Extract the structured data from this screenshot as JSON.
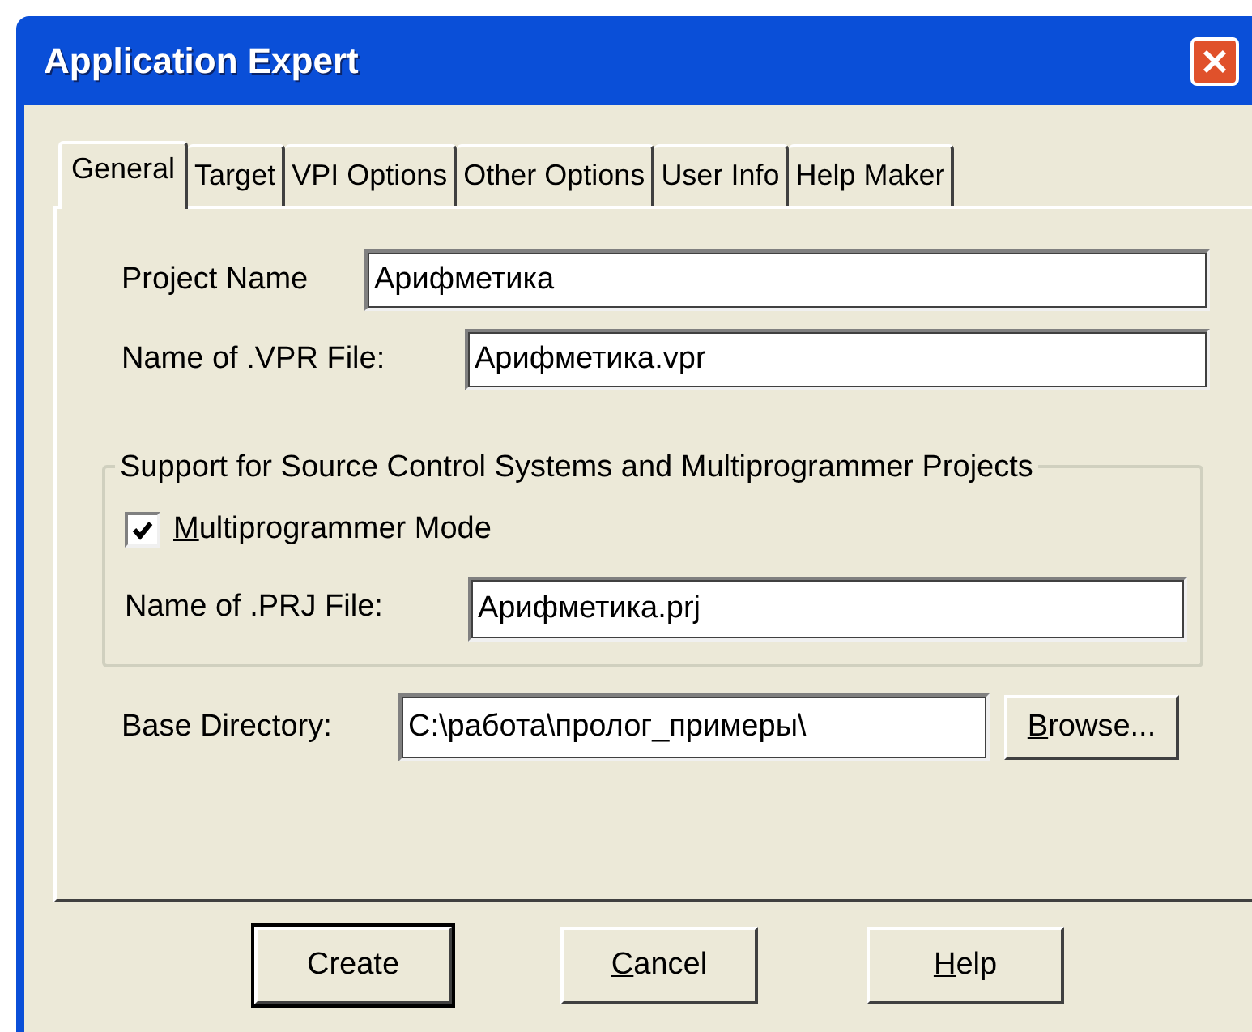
{
  "window": {
    "title": "Application Expert"
  },
  "tabs": [
    {
      "label": "General",
      "selected": true
    },
    {
      "label": "Target",
      "selected": false
    },
    {
      "label": "VPI Options",
      "selected": false
    },
    {
      "label": "Other Options",
      "selected": false
    },
    {
      "label": "User Info",
      "selected": false
    },
    {
      "label": "Help Maker",
      "selected": false
    }
  ],
  "fields": [
    {
      "label": "Project Name",
      "value": "Арифметика"
    },
    {
      "label": "Name of .VPR File:",
      "value": "Арифметика.vpr"
    }
  ],
  "group": {
    "title": "Support for Source Control Systems and Multiprogrammer Projects",
    "checkbox": {
      "key": "M",
      "rest": "ultiprogrammer Mode",
      "checked": true
    },
    "field": {
      "label": "Name of .PRJ File:",
      "value": "Арифметика.prj"
    }
  },
  "base_directory": {
    "label": "Base Directory:",
    "value": "C:\\работа\\пролог_примеры\\",
    "button": {
      "key": "B",
      "rest": "rowse..."
    }
  },
  "buttons": [
    {
      "rest": "Create",
      "default": true
    },
    {
      "key": "C",
      "rest": "ancel",
      "default": false
    },
    {
      "key": "H",
      "rest": "elp",
      "default": false
    }
  ]
}
